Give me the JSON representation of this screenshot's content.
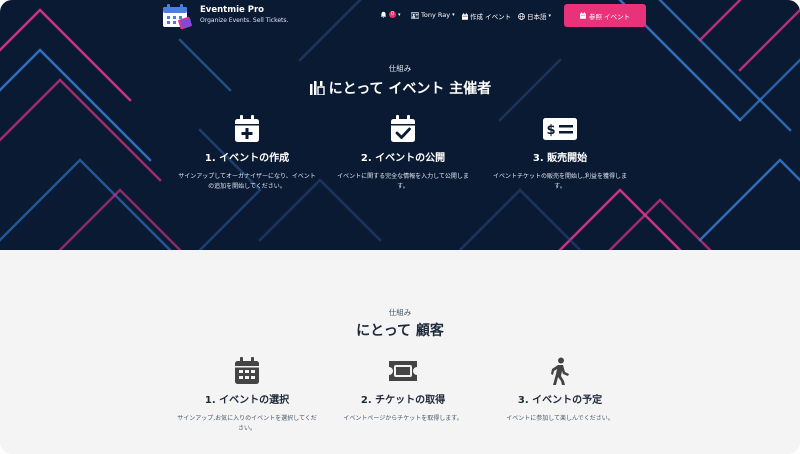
{
  "nav": {
    "brand": "Eventmie Pro",
    "tagline": "Organize Events. Sell Tickets.",
    "notifications_count": "0",
    "user": "Tony Ray",
    "create_event": "作成 イベント",
    "language": "日本語",
    "cta": "参照 イベント"
  },
  "organizer": {
    "kicker": "仕組み",
    "title": "にとって イベント 主催者",
    "steps": [
      {
        "title": "1. イベントの作成",
        "desc": "サインアップしてオーガナイザーになり、イベントの追加を開始してください。",
        "icon": "calendar-plus-icon"
      },
      {
        "title": "2. イベントの公開",
        "desc": "イベントに関する完全な情報を入力して公開します。",
        "icon": "calendar-check-icon"
      },
      {
        "title": "3. 販売開始",
        "desc": "イベントチケットの販売を開始し,利益を獲得します。",
        "icon": "money-bill-icon"
      }
    ]
  },
  "customer": {
    "kicker": "仕組み",
    "title": "にとって 顧客",
    "steps": [
      {
        "title": "1. イベントの選択",
        "desc": "サインアップ,お気に入りのイベントを選択してください。",
        "icon": "calendar-grid-icon"
      },
      {
        "title": "2. チケットの取得",
        "desc": "イベントページからチケットを取得します。",
        "icon": "ticket-icon"
      },
      {
        "title": "3. イベントの予定",
        "desc": "イベントに参加して楽しんでください。",
        "icon": "walking-person-icon"
      }
    ]
  },
  "colors": {
    "hero_bg": "#0b1a33",
    "accent_pink": "#e8327a",
    "line_blue": "#3b7fd6",
    "section_bg": "#f4f4f4"
  }
}
